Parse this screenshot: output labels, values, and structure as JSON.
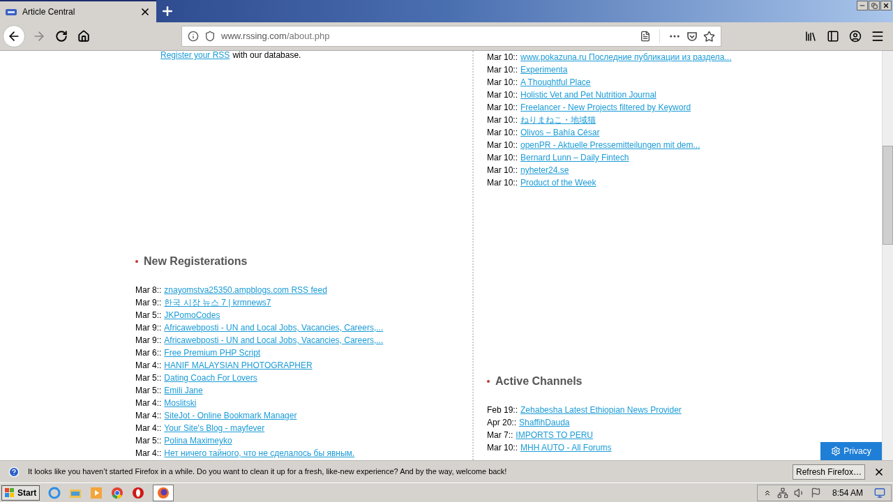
{
  "browser": {
    "tab": {
      "title": "Article Central",
      "selected": true
    },
    "url": {
      "host": "www.rssing.com",
      "path": "/about.php"
    }
  },
  "page": {
    "register": {
      "link": "Register your RSS",
      "text": "with our database."
    },
    "new_registrations": {
      "title": "New Registerations",
      "items": [
        {
          "date": "Mar 8::",
          "title": "znayomstva25350.ampblogs.com RSS feed"
        },
        {
          "date": "Mar 9::",
          "title": "한국 시장 뉴스 7 | krmnews7"
        },
        {
          "date": "Mar 5::",
          "title": "JKPomoCodes"
        },
        {
          "date": "Mar 9::",
          "title": "Africawebposti - UN and Local Jobs, Vacancies, Careers,..."
        },
        {
          "date": "Mar 9::",
          "title": "Africawebposti - UN and Local Jobs, Vacancies, Careers,..."
        },
        {
          "date": "Mar 6::",
          "title": "Free Premium PHP Script"
        },
        {
          "date": "Mar 4::",
          "title": "HANIF MALAYSIAN PHOTOGRAPHER"
        },
        {
          "date": "Mar 5::",
          "title": "Dating Coach For Lovers"
        },
        {
          "date": "Mar 5::",
          "title": "Emili Jane"
        },
        {
          "date": "Mar 4::",
          "title": "Moslitski"
        },
        {
          "date": "Mar 4::",
          "title": "SiteJot - Online Bookmark Manager"
        },
        {
          "date": "Mar 4::",
          "title": "Your Site's Blog - mayfever"
        },
        {
          "date": "Mar 5::",
          "title": "Polina Maximeyko"
        },
        {
          "date": "Mar 4::",
          "title": "Нет ничего тайного, что не сделалось бы явным."
        }
      ]
    },
    "recent": {
      "items": [
        {
          "date": "Mar 10::",
          "title": "www.pokazuna.ru Последние публикации из раздела..."
        },
        {
          "date": "Mar 10::",
          "title": "Experimenta"
        },
        {
          "date": "Mar 10::",
          "title": "A Thoughtful Place"
        },
        {
          "date": "Mar 10::",
          "title": "Holistic Vet and Pet Nutrition Journal"
        },
        {
          "date": "Mar 10::",
          "title": "Freelancer - New Projects filtered by Keyword"
        },
        {
          "date": "Mar 10::",
          "title": "ねりまねこ・地域猫"
        },
        {
          "date": "Mar 10::",
          "title": "Olivos – Bahía César"
        },
        {
          "date": "Mar 10::",
          "title": "openPR - Aktuelle Pressemitteilungen mit dem..."
        },
        {
          "date": "Mar 10::",
          "title": "Bernard Lunn – Daily Fintech"
        },
        {
          "date": "Mar 10::",
          "title": "nyheter24.se"
        },
        {
          "date": "Mar 10::",
          "title": "Product of the Week"
        }
      ]
    },
    "active_channels": {
      "title": "Active Channels",
      "items": [
        {
          "date": "Feb 19::",
          "title": "Zehabesha Latest Ethiopian News Provider"
        },
        {
          "date": "Apr 20::",
          "title": "ShaffihDauda"
        },
        {
          "date": "Mar 7::",
          "title": "IMPORTS TO PERU"
        },
        {
          "date": "Mar 10::",
          "title": "MHH AUTO - All Forums"
        }
      ]
    },
    "privacy_button": "Privacy"
  },
  "notification": {
    "message": "It looks like you haven’t started Firefox in a while. Do you want to clean it up for a fresh, like-new experience? And by the way, welcome back!",
    "button": "Refresh Firefox…"
  },
  "taskbar": {
    "start": "Start",
    "clock": "8:54 AM"
  }
}
